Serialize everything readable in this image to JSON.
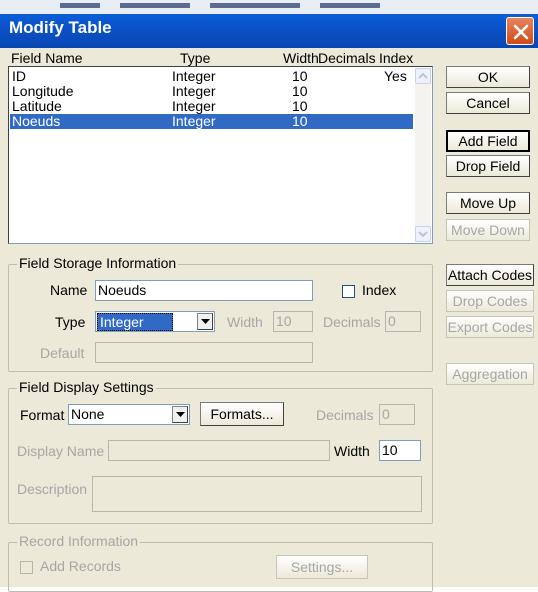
{
  "window": {
    "title": "Modify Table"
  },
  "columns": {
    "field_name": "Field Name",
    "type": "Type",
    "width": "Width",
    "decimals": "Decimals",
    "index": "Index"
  },
  "rows": [
    {
      "name": "ID",
      "type": "Integer",
      "width": "10",
      "index": "Yes",
      "selected": false
    },
    {
      "name": "Longitude",
      "type": "Integer",
      "width": "10",
      "index": "",
      "selected": false
    },
    {
      "name": "Latitude",
      "type": "Integer",
      "width": "10",
      "index": "",
      "selected": false
    },
    {
      "name": "Noeuds",
      "type": "Integer",
      "width": "10",
      "index": "",
      "selected": true
    }
  ],
  "buttons": {
    "ok": "OK",
    "cancel": "Cancel",
    "add_field": "Add Field",
    "drop_field": "Drop Field",
    "move_up": "Move Up",
    "move_down": "Move Down",
    "attach_codes": "Attach Codes",
    "drop_codes": "Drop Codes",
    "export_codes": "Export Codes",
    "aggregation": "Aggregation"
  },
  "storage": {
    "title": "Field Storage Information",
    "name_label": "Name",
    "name_value": "Noeuds",
    "index_label": "Index",
    "type_label": "Type",
    "type_value": "Integer",
    "width_label": "Width",
    "width_value": "10",
    "decimals_label": "Decimals",
    "decimals_value": "0",
    "default_label": "Default",
    "default_value": ""
  },
  "display": {
    "title": "Field Display Settings",
    "format_label": "Format",
    "format_value": "None",
    "formats_button": "Formats...",
    "decimals_label": "Decimals",
    "decimals_value": "0",
    "display_name_label": "Display Name",
    "display_name_value": "",
    "width_label": "Width",
    "width_value": "10",
    "description_label": "Description",
    "description_value": ""
  },
  "record": {
    "title": "Record Information",
    "add_records_label": "Add Records",
    "settings_button": "Settings..."
  },
  "colors": {
    "title_bar": "#0b52c7",
    "selection": "#316ac5",
    "dialog_bg": "#ece9d8"
  }
}
